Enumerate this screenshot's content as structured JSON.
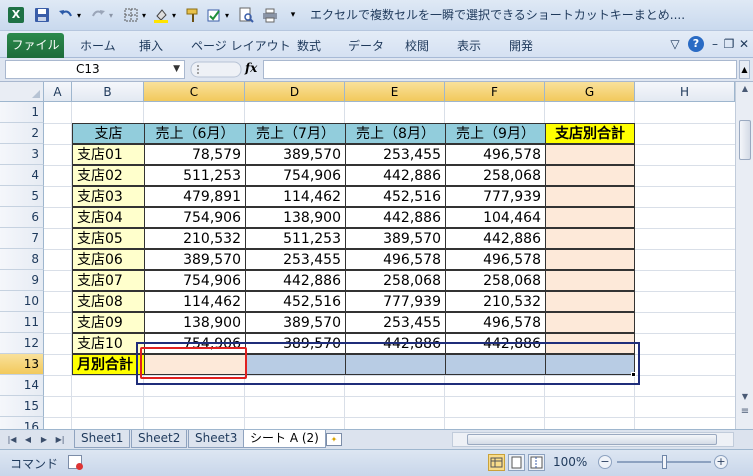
{
  "window": {
    "title": "エクセルで複数セルを一瞬で選択できるショートカットキーまとめ...."
  },
  "ribbon": {
    "file_tab": "ファイル",
    "tabs": [
      "ホーム",
      "挿入",
      "ページ レイアウト",
      "数式",
      "データ",
      "校閲",
      "表示",
      "開発"
    ]
  },
  "formula_bar": {
    "name_box": "C13",
    "fx_label": "fx",
    "content": ""
  },
  "grid": {
    "columns": [
      "A",
      "B",
      "C",
      "D",
      "E",
      "F",
      "G",
      "H"
    ],
    "selected_columns": [
      "C",
      "D",
      "E",
      "F",
      "G"
    ],
    "rows": [
      "1",
      "2",
      "3",
      "4",
      "5",
      "6",
      "7",
      "8",
      "9",
      "10",
      "11",
      "12",
      "13",
      "14",
      "15",
      "16"
    ],
    "selected_row": "13"
  },
  "table": {
    "header_branch": "支店",
    "headers": [
      "売上（6月）",
      "売上（7月）",
      "売上（8月）",
      "売上（9月）"
    ],
    "header_total": "支店別合計",
    "rows": [
      {
        "branch": "支店01",
        "values": [
          "78,579",
          "389,570",
          "253,455",
          "496,578"
        ]
      },
      {
        "branch": "支店02",
        "values": [
          "511,253",
          "754,906",
          "442,886",
          "258,068"
        ]
      },
      {
        "branch": "支店03",
        "values": [
          "479,891",
          "114,462",
          "452,516",
          "777,939"
        ]
      },
      {
        "branch": "支店04",
        "values": [
          "754,906",
          "138,900",
          "442,886",
          "104,464"
        ]
      },
      {
        "branch": "支店05",
        "values": [
          "210,532",
          "511,253",
          "389,570",
          "442,886"
        ]
      },
      {
        "branch": "支店06",
        "values": [
          "389,570",
          "253,455",
          "496,578",
          "496,578"
        ]
      },
      {
        "branch": "支店07",
        "values": [
          "754,906",
          "442,886",
          "258,068",
          "258,068"
        ]
      },
      {
        "branch": "支店08",
        "values": [
          "114,462",
          "452,516",
          "777,939",
          "210,532"
        ]
      },
      {
        "branch": "支店09",
        "values": [
          "138,900",
          "389,570",
          "253,455",
          "496,578"
        ]
      },
      {
        "branch": "支店10",
        "values": [
          "754,906",
          "389,570",
          "442,886",
          "442,886"
        ]
      }
    ],
    "month_total_label": "月別合計"
  },
  "sheets": {
    "tabs": [
      "Sheet1",
      "Sheet2",
      "Sheet3",
      "シート A (2)"
    ],
    "active": "シート A (2)"
  },
  "status": {
    "mode": "コマンド",
    "zoom": "100%"
  },
  "colors": {
    "header_fill": "#92cddc",
    "total_header_fill": "#ffff00",
    "branch_fill": "#ffffcc",
    "total_fill": "#fde9d9",
    "selection_fill": "#b8cce4",
    "selection_outline": "#1f2d7a",
    "active_cell_outline": "#e02020"
  }
}
